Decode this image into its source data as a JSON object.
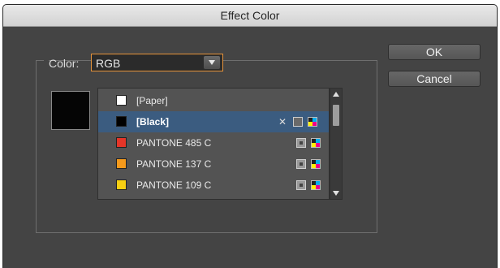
{
  "dialog": {
    "title": "Effect Color"
  },
  "color": {
    "label": "Color:",
    "selected": "RGB"
  },
  "preview": {
    "color": "#050505"
  },
  "swatches": [
    {
      "name": "[Paper]",
      "color": "#ffffff",
      "icons": []
    },
    {
      "name": "[Black]",
      "color": "#000000",
      "selected": true,
      "icons": [
        "no-edit-icon",
        "none-icon",
        "cmyk-icon"
      ]
    },
    {
      "name": "PANTONE 485 C",
      "color": "#e53528",
      "icons": [
        "spot-color-icon",
        "cmyk-icon"
      ]
    },
    {
      "name": "PANTONE 137 C",
      "color": "#f59a1c",
      "icons": [
        "spot-color-icon",
        "cmyk-icon"
      ]
    },
    {
      "name": "PANTONE 109 C",
      "color": "#f7cf12",
      "icons": [
        "spot-color-icon",
        "cmyk-icon"
      ]
    }
  ],
  "buttons": {
    "ok": "OK",
    "cancel": "Cancel"
  },
  "accent": "#e6933a",
  "selection_color": "#3b5c80"
}
